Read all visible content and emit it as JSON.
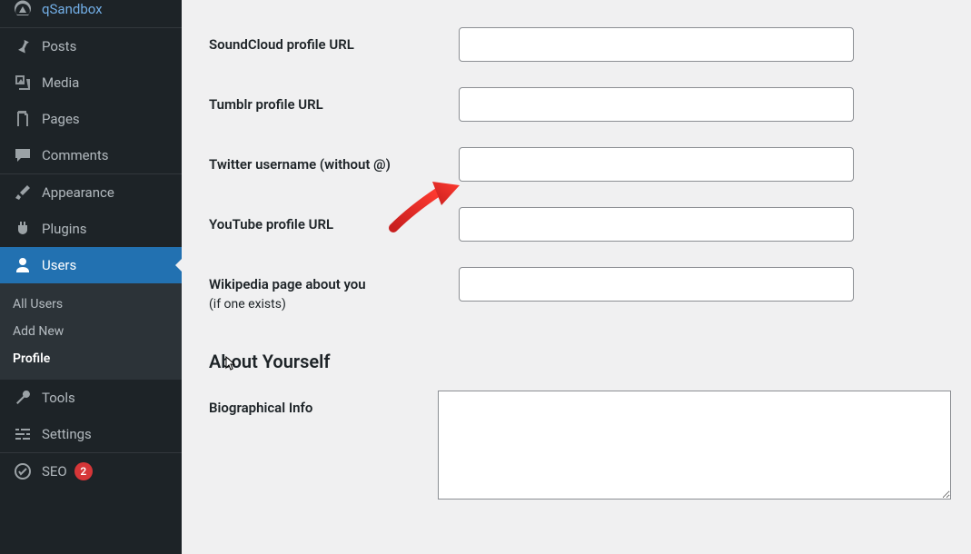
{
  "sidebar": {
    "items": [
      {
        "label": "qSandbox"
      },
      {
        "label": "Posts"
      },
      {
        "label": "Media"
      },
      {
        "label": "Pages"
      },
      {
        "label": "Comments"
      },
      {
        "label": "Appearance"
      },
      {
        "label": "Plugins"
      },
      {
        "label": "Users"
      },
      {
        "label": "Tools"
      },
      {
        "label": "Settings"
      },
      {
        "label": "SEO",
        "badge": "2"
      }
    ],
    "submenu": [
      {
        "label": "All Users"
      },
      {
        "label": "Add New"
      },
      {
        "label": "Profile"
      }
    ]
  },
  "form": {
    "soundcloud": {
      "label": "SoundCloud profile URL",
      "value": ""
    },
    "tumblr": {
      "label": "Tumblr profile URL",
      "value": ""
    },
    "twitter": {
      "label": "Twitter username (without @)",
      "value": ""
    },
    "youtube": {
      "label": "YouTube profile URL",
      "value": ""
    },
    "wikipedia": {
      "label": "Wikipedia page about you",
      "hint": "(if one exists)",
      "value": ""
    },
    "bio": {
      "label": "Biographical Info",
      "value": ""
    }
  },
  "sections": {
    "about": "About Yourself"
  }
}
